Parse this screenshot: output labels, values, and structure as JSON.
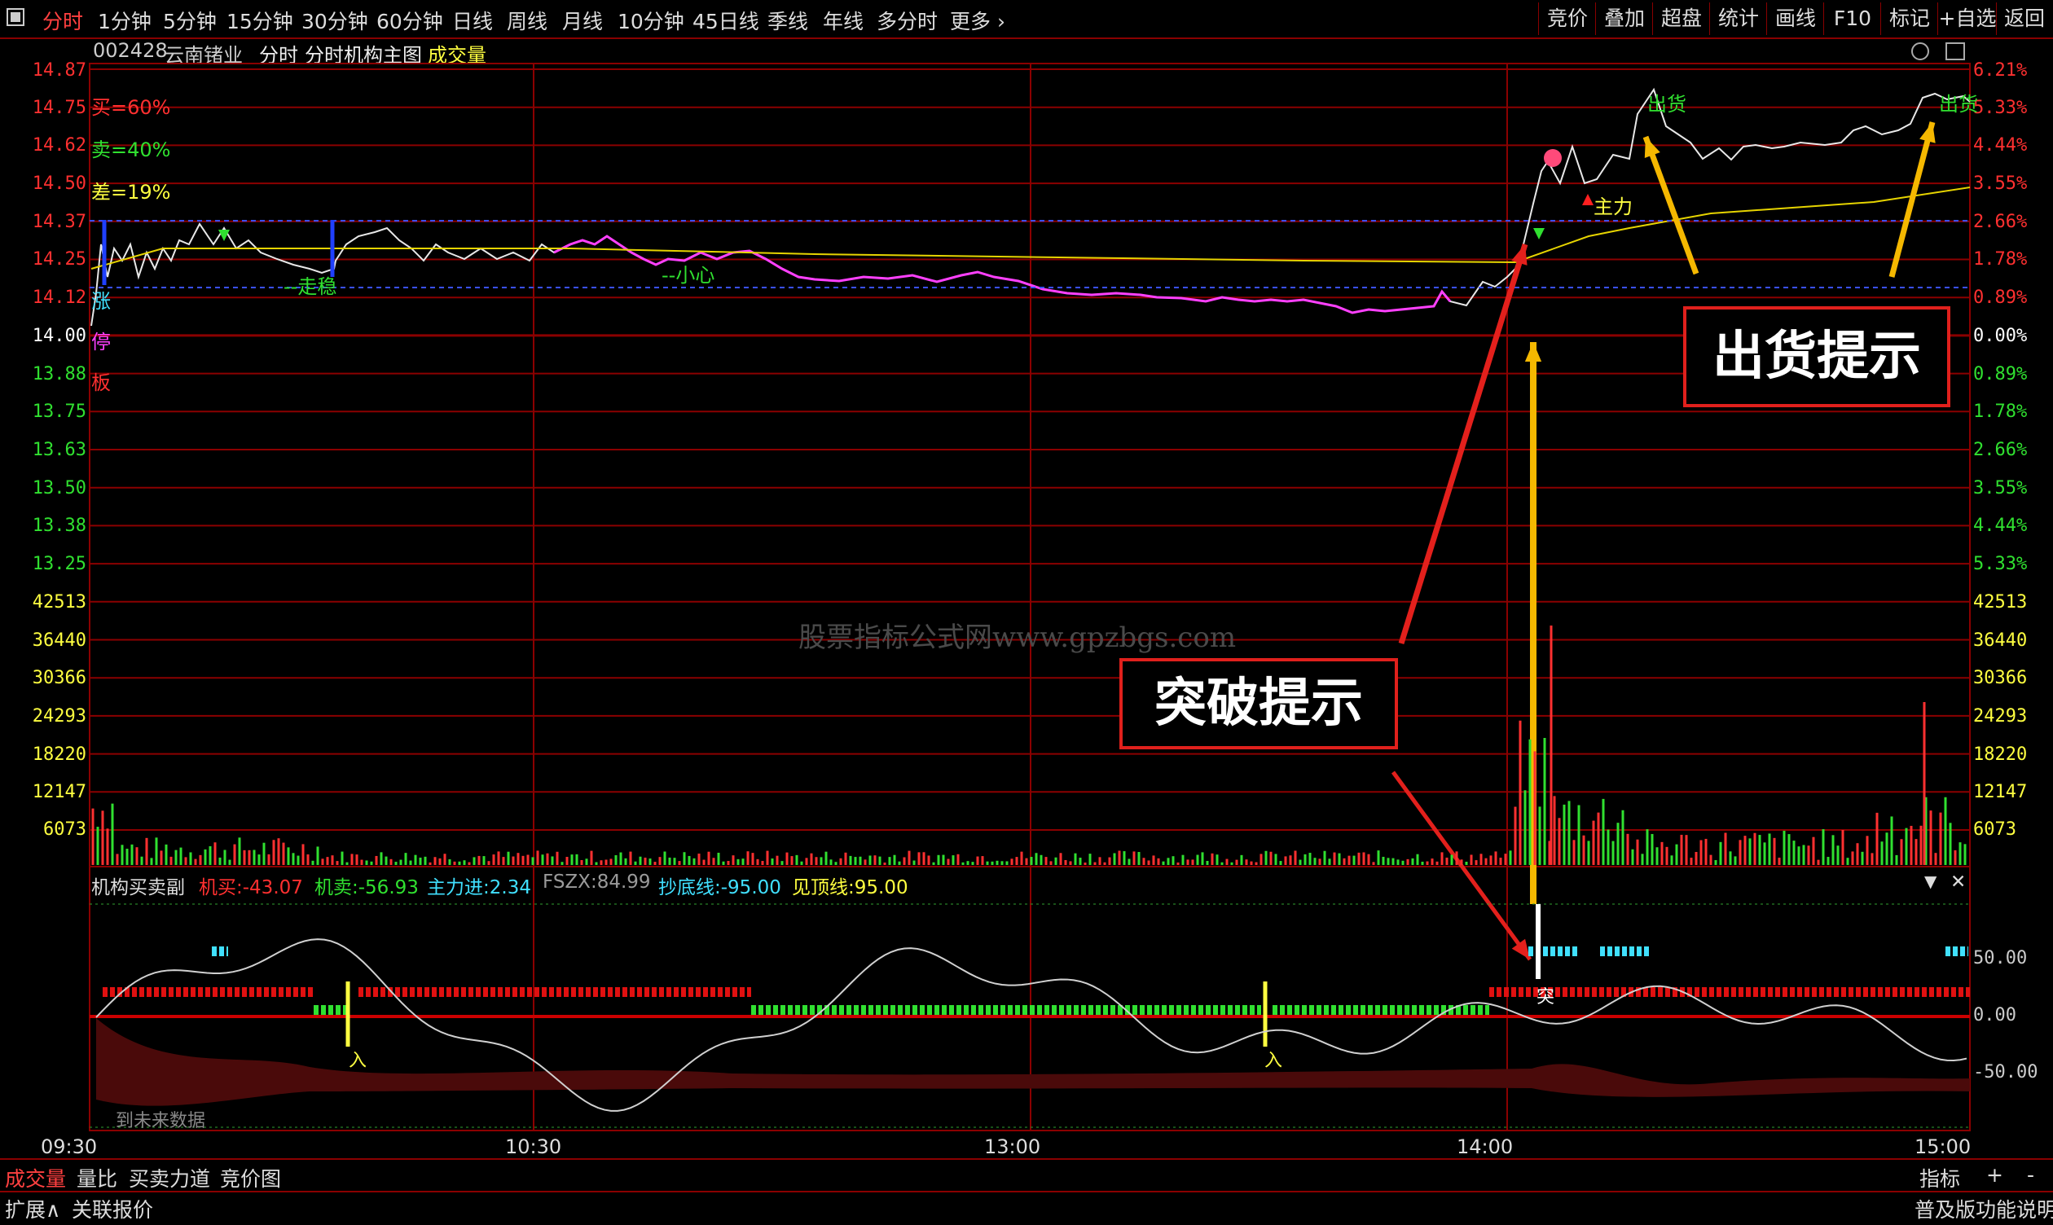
{
  "toolbar": {
    "periods": [
      "分时",
      "1分钟",
      "5分钟",
      "15分钟",
      "30分钟",
      "60分钟",
      "日线",
      "周线",
      "月线",
      "10分钟",
      "45日线",
      "季线",
      "年线",
      "多分时",
      "更多"
    ],
    "active_period": "分时",
    "right_buttons": [
      "竞价",
      "叠加",
      "超盘",
      "统计",
      "画线",
      "F10",
      "标记",
      "+自选",
      "返回"
    ]
  },
  "header": {
    "code": "002428",
    "name": "云南锗业",
    "view": "分时",
    "indicator": "分时机构主图",
    "volume_label": "成交量"
  },
  "price_panel": {
    "left_price_labels": [
      "14.87",
      "14.75",
      "14.62",
      "14.50",
      "14.37",
      "14.25",
      "14.12",
      "14.00",
      "13.88",
      "13.75",
      "13.63",
      "13.50",
      "13.38",
      "13.25"
    ],
    "right_pct_labels": [
      "6.21%",
      "5.33%",
      "4.44%",
      "3.55%",
      "2.66%",
      "1.78%",
      "0.89%",
      "0.00%",
      "0.89%",
      "1.78%",
      "2.66%",
      "3.55%",
      "4.44%",
      "5.33%"
    ],
    "stats": [
      {
        "label": "买=",
        "value": "60%",
        "color": "#ff3030"
      },
      {
        "label": "卖=",
        "value": "40%",
        "color": "#30e030"
      },
      {
        "label": "差=",
        "value": "19%",
        "color": "#ffff40"
      }
    ],
    "side_chars": [
      "涨",
      "停",
      "板"
    ],
    "annotations": [
      "--走稳",
      "--小心",
      "主力",
      "出货",
      "出货"
    ],
    "callout_breakout": "突破提示",
    "callout_sell": "出货提示"
  },
  "volume_panel": {
    "labels": [
      "42513",
      "36440",
      "30366",
      "24293",
      "18220",
      "12147",
      "6073"
    ]
  },
  "indicator_panel": {
    "name": "机构买卖副",
    "values": [
      {
        "label": "机买:",
        "value": "-43.07",
        "color": "#ff3030"
      },
      {
        "label": "机卖:",
        "value": "-56.93",
        "color": "#30e030"
      },
      {
        "label": "主力进:",
        "value": "2.34",
        "color": "#40e0ff"
      },
      {
        "label": "FSZX:",
        "value": "84.99",
        "color": "#9a9a9a"
      },
      {
        "label": "抄底线:",
        "value": "-95.00",
        "color": "#40e0ff"
      },
      {
        "label": "见顶线:",
        "value": "95.00",
        "color": "#ffff40"
      }
    ],
    "right_labels": [
      "50.00",
      "0.00",
      "-50.00"
    ],
    "markers": [
      "入",
      "入",
      "突"
    ],
    "future_note": "到未来数据"
  },
  "time_axis": [
    "09:30",
    "10:30",
    "13:00",
    "14:00",
    "15:00"
  ],
  "bottom_tabs": [
    "成交量",
    "量比",
    "买卖力道",
    "竞价图"
  ],
  "bottom_right_tabs": [
    "指标",
    "+",
    "-"
  ],
  "status_bar": {
    "left": [
      "扩展∧",
      "关联报价"
    ],
    "right": "普及版功能说明"
  },
  "watermark": "股票指标公式网www.gpzbgs.com",
  "colors": {
    "grid": "#8b0000",
    "up": "#ff3030",
    "down": "#30e030",
    "avg": "#ffff40",
    "accent": "#ff4040"
  }
}
